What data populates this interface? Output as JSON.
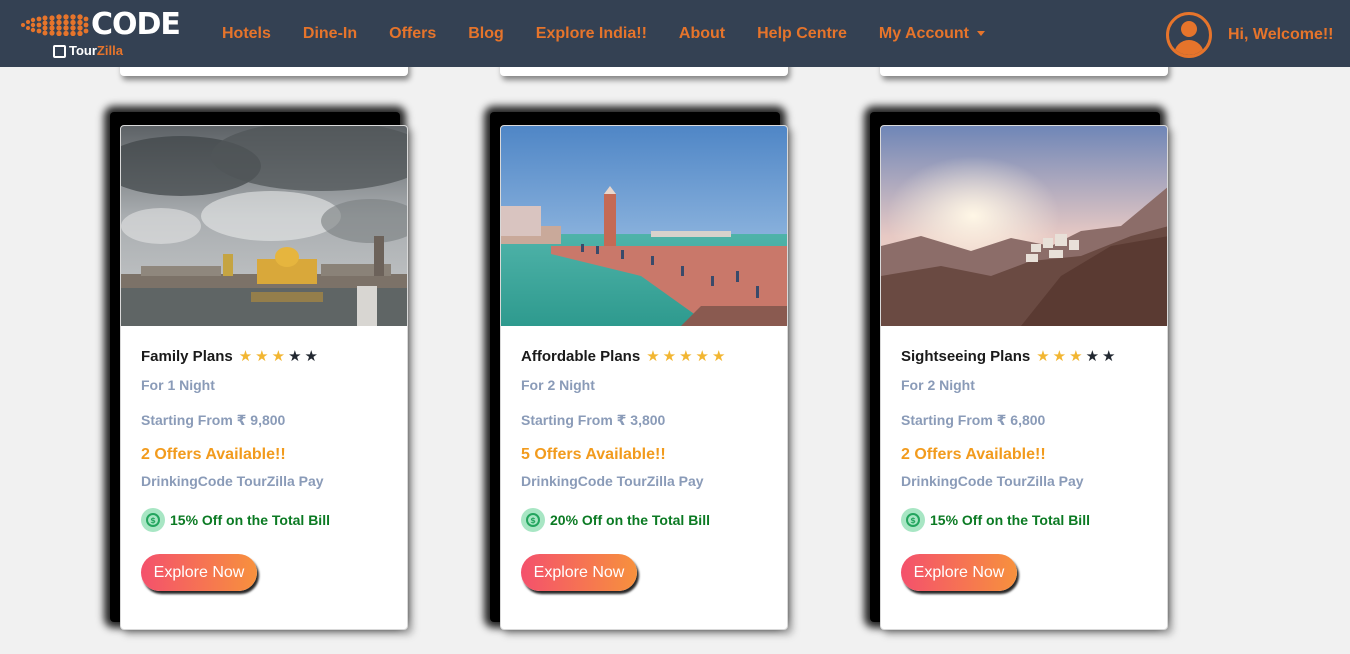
{
  "navbar": {
    "logo": {
      "wordmark": "CODE",
      "sub_part1": "Tour",
      "sub_part2": "Zilla"
    },
    "links": [
      {
        "label": "Hotels"
      },
      {
        "label": "Dine-In"
      },
      {
        "label": "Offers"
      },
      {
        "label": "Blog"
      },
      {
        "label": "Explore India!!"
      },
      {
        "label": "About"
      },
      {
        "label": "Help Centre"
      },
      {
        "label": "My Account"
      }
    ],
    "welcome": "Hi, Welcome!!"
  },
  "colors": {
    "navbar_bg": "#344153",
    "accent": "#e6742b",
    "offers_text": "#f29b1d",
    "discount_text": "#0b7a23",
    "button_gradient": [
      "#f4516c",
      "#f7913d"
    ]
  },
  "cards": [
    {
      "title": "Family Plans",
      "rating": 3,
      "rating_max": 5,
      "nights": "For 1 Night",
      "price": "Starting From ₹ 9,800",
      "offers": "2 Offers Available!!",
      "pay": "DrinkingCode TourZilla Pay",
      "discount": "15% Off on the Total Bill",
      "button": "Explore Now",
      "image": "golden-temple-photo"
    },
    {
      "title": "Affordable Plans",
      "rating": 5,
      "rating_max": 5,
      "nights": "For 2 Night",
      "price": "Starting From ₹ 3,800",
      "offers": "5 Offers Available!!",
      "pay": "DrinkingCode TourZilla Pay",
      "discount": "20% Off on the Total Bill",
      "button": "Explore Now",
      "image": "haridwar-ghat-photo"
    },
    {
      "title": "Sightseeing Plans",
      "rating": 3,
      "rating_max": 5,
      "nights": "For 2 Night",
      "price": "Starting From ₹ 6,800",
      "offers": "2 Offers Available!!",
      "pay": "DrinkingCode TourZilla Pay",
      "discount": "15% Off on the Total Bill",
      "button": "Explore Now",
      "image": "mountain-monastery-photo"
    }
  ]
}
